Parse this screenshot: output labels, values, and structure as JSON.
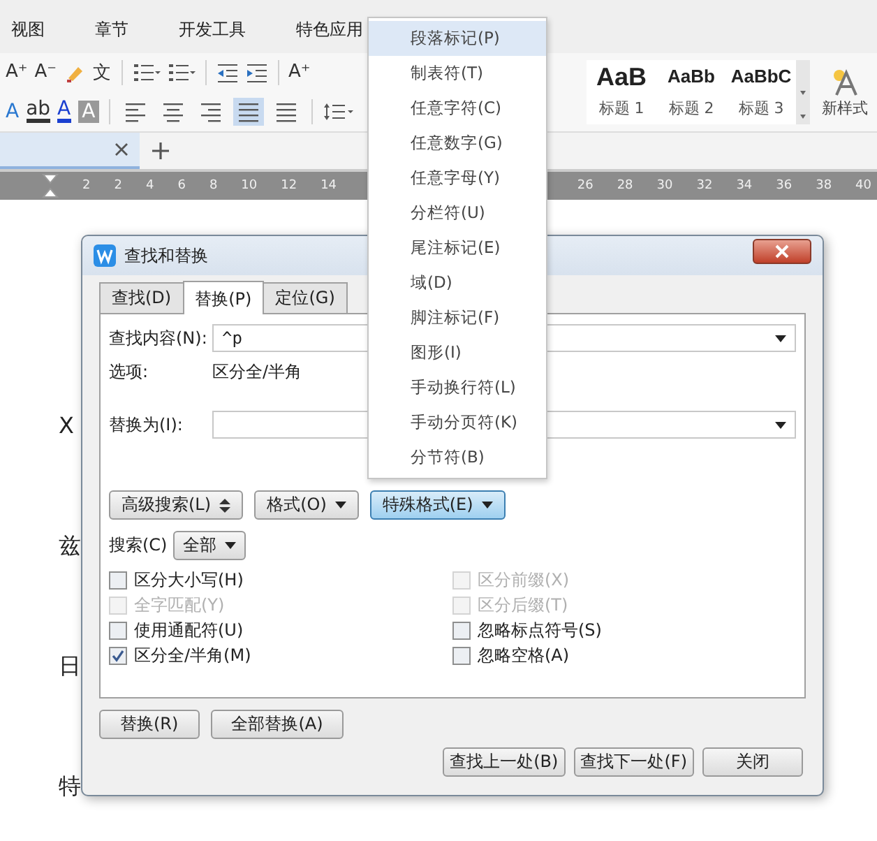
{
  "menu_tabs": [
    {
      "label": "视图"
    },
    {
      "label": "章节"
    },
    {
      "label": "开发工具"
    },
    {
      "label": "特色应用"
    }
  ],
  "toolbar": {
    "row1": [
      {
        "kind": "glyph",
        "text": "A⁺"
      },
      {
        "kind": "glyph",
        "text": "A⁻"
      },
      {
        "kind": "brush"
      },
      {
        "kind": "glyph",
        "text": "文"
      },
      {
        "kind": "sep"
      },
      {
        "kind": "bullets"
      },
      {
        "kind": "numbering"
      },
      {
        "kind": "sep"
      },
      {
        "kind": "outdent"
      },
      {
        "kind": "indent"
      },
      {
        "kind": "sep"
      },
      {
        "kind": "glyph",
        "text": "A⁺"
      }
    ],
    "row2": [
      {
        "kind": "glyph",
        "text": "A"
      },
      {
        "kind": "highlight",
        "text": "ab"
      },
      {
        "kind": "font-color",
        "text": "A"
      },
      {
        "kind": "shaded",
        "text": "A"
      }
    ],
    "alignment": [
      {
        "kind": "left",
        "selected": false
      },
      {
        "kind": "center",
        "selected": false
      },
      {
        "kind": "right",
        "selected": false
      },
      {
        "kind": "justify",
        "selected": true
      },
      {
        "kind": "distribute",
        "selected": false
      }
    ]
  },
  "styles": [
    {
      "sample": "AaB",
      "label": "标题 1"
    },
    {
      "sample": "AaBb",
      "label": "标题 2"
    },
    {
      "sample": "AaBbC",
      "label": "标题 3"
    }
  ],
  "new_style": "新样式",
  "ruler": {
    "left_labels": [
      "2",
      "2",
      "4",
      "6",
      "8",
      "10",
      "12",
      "14"
    ],
    "right_labels": [
      "26",
      "28",
      "30",
      "32",
      "34",
      "36",
      "38",
      "40"
    ]
  },
  "document_text": [
    "X",
    "兹",
    "日",
    "特"
  ],
  "dialog": {
    "title": "查找和替换",
    "tabs": [
      {
        "label": "查找(D)",
        "selected": false
      },
      {
        "label": "替换(P)",
        "selected": true
      },
      {
        "label": "定位(G)",
        "selected": false
      }
    ],
    "find": {
      "label": "查找内容(N):",
      "value": "^p"
    },
    "options": {
      "label": "选项:",
      "value": "区分全/半角"
    },
    "replace": {
      "label": "替换为(I):"
    },
    "action_buttons": [
      {
        "kind": "updown",
        "label": "高级搜索(L)",
        "selected": false
      },
      {
        "kind": "dropdown",
        "label": "格式(O)",
        "selected": false
      },
      {
        "kind": "dropdown",
        "label": "特殊格式(E)",
        "selected": true
      }
    ],
    "search": {
      "label": "搜索(C)",
      "value": "全部"
    },
    "checks_left": [
      {
        "label": "区分大小写(H)",
        "checked": false,
        "disabled": false
      },
      {
        "label": "全字匹配(Y)",
        "checked": false,
        "disabled": true
      },
      {
        "label": "使用通配符(U)",
        "checked": false,
        "disabled": false
      },
      {
        "label": "区分全/半角(M)",
        "checked": true,
        "disabled": false
      }
    ],
    "checks_right": [
      {
        "label": "区分前缀(X)",
        "checked": false,
        "disabled": true
      },
      {
        "label": "区分后缀(T)",
        "checked": false,
        "disabled": true
      },
      {
        "label": "忽略标点符号(S)",
        "checked": false,
        "disabled": false
      },
      {
        "label": "忽略空格(A)",
        "checked": false,
        "disabled": false
      }
    ],
    "replace_buttons": [
      "替换(R)",
      "全部替换(A)"
    ],
    "nav_buttons": [
      "查找上一处(B)",
      "查找下一处(F)",
      "关闭"
    ]
  },
  "special_menu": [
    {
      "label": "段落标记(P)",
      "selected": true
    },
    {
      "label": "制表符(T)",
      "selected": false
    },
    {
      "label": "任意字符(C)",
      "selected": false
    },
    {
      "label": "任意数字(G)",
      "selected": false
    },
    {
      "label": "任意字母(Y)",
      "selected": false
    },
    {
      "label": "分栏符(U)",
      "selected": false
    },
    {
      "label": "尾注标记(E)",
      "selected": false
    },
    {
      "label": "域(D)",
      "selected": false
    },
    {
      "label": "脚注标记(F)",
      "selected": false
    },
    {
      "label": "图形(I)",
      "selected": false
    },
    {
      "label": "手动换行符(L)",
      "selected": false
    },
    {
      "label": "手动分页符(K)",
      "selected": false
    },
    {
      "label": "分节符(B)",
      "selected": false
    }
  ]
}
